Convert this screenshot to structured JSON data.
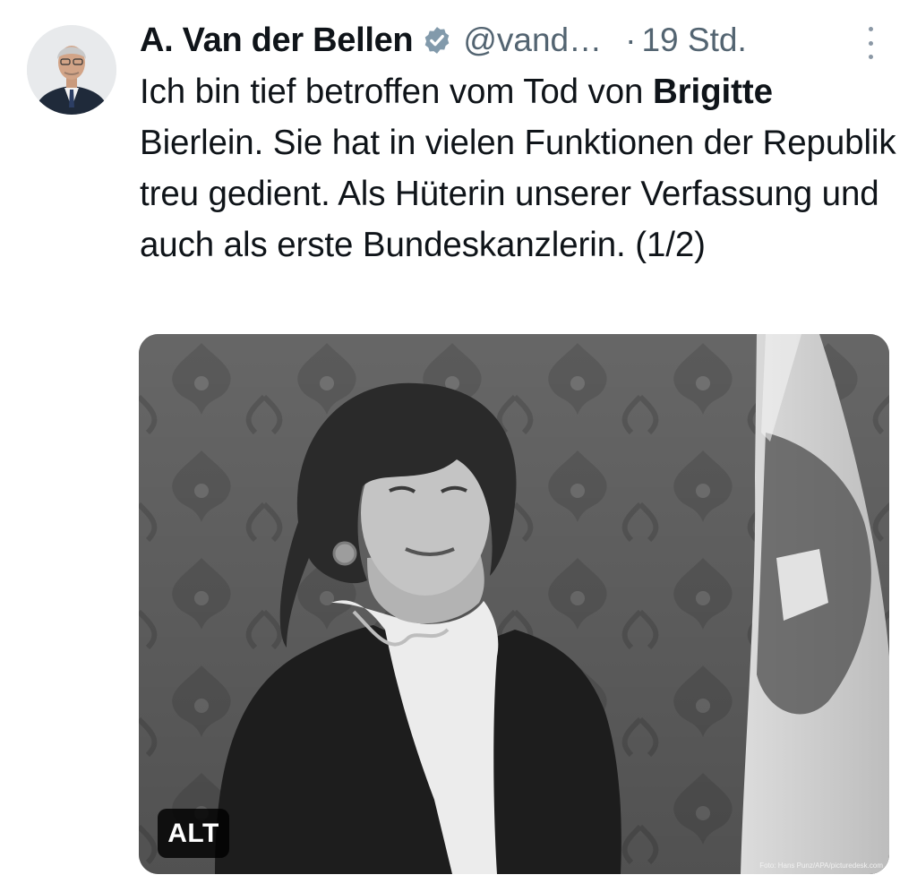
{
  "tweet": {
    "author_name": "A. Van der Bellen",
    "handle": "@vand…",
    "separator": "·",
    "time": "19 Std.",
    "text_before_bold": "Ich bin tief betroffen vom Tod von ",
    "text_bold": "Brigitte",
    "text_after_bold": " Bierlein. Sie hat in vielen Funktionen der Republik treu gedient. Als Hüterin unserer Verfassung und auch als erste Bundeskanzlerin. (1/2)",
    "media": {
      "alt_label": "ALT",
      "photo_credit": "Foto: Hans Punz/APA/picturedesk.com"
    }
  },
  "icons": {
    "verified": "verified-badge-icon",
    "more": "more-options-icon",
    "avatar": "avatar-portrait"
  },
  "colors": {
    "text_primary": "#0f1419",
    "text_secondary": "#536471",
    "verified_badge": "#829aab"
  }
}
